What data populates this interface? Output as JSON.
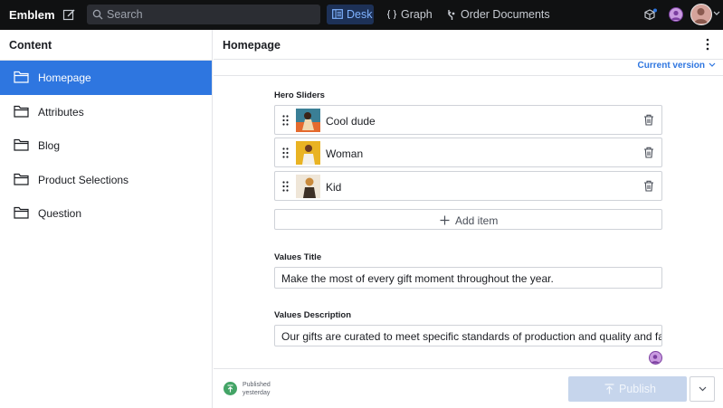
{
  "topbar": {
    "brand": "Emblem",
    "search_placeholder": "Search",
    "tools": [
      {
        "label": "Desk",
        "active": true
      },
      {
        "label": "Graph",
        "active": false
      },
      {
        "label": "Order Documents",
        "active": false
      }
    ]
  },
  "sidebar": {
    "title": "Content",
    "items": [
      {
        "label": "Homepage",
        "active": true,
        "icon": "folder-icon"
      },
      {
        "label": "Attributes",
        "active": false,
        "icon": "folder-icon"
      },
      {
        "label": "Blog",
        "active": false,
        "icon": "folder-icon"
      },
      {
        "label": "Product Selections",
        "active": false,
        "icon": "folder-icon"
      },
      {
        "label": "Question",
        "active": false,
        "icon": "folder-icon"
      }
    ]
  },
  "document": {
    "title": "Homepage",
    "version_label": "Current version",
    "hero_sliders": {
      "label": "Hero Sliders",
      "items": [
        {
          "name": "Cool dude"
        },
        {
          "name": "Woman"
        },
        {
          "name": "Kid"
        }
      ],
      "add_label": "Add item"
    },
    "values_title": {
      "label": "Values Title",
      "value": "Make the most of every gift moment throughout the year."
    },
    "values_description": {
      "label": "Values Description",
      "value": "Our gifts are curated to meet specific standards of production and quality and fall in c"
    }
  },
  "footer": {
    "status": "Published",
    "status_time": "yesterday",
    "publish_label": "Publish"
  },
  "colors": {
    "topbar_bg": "#101112",
    "accent": "#2e76e0",
    "published": "#43a466",
    "publish_disabled": "#c6d5ec"
  }
}
